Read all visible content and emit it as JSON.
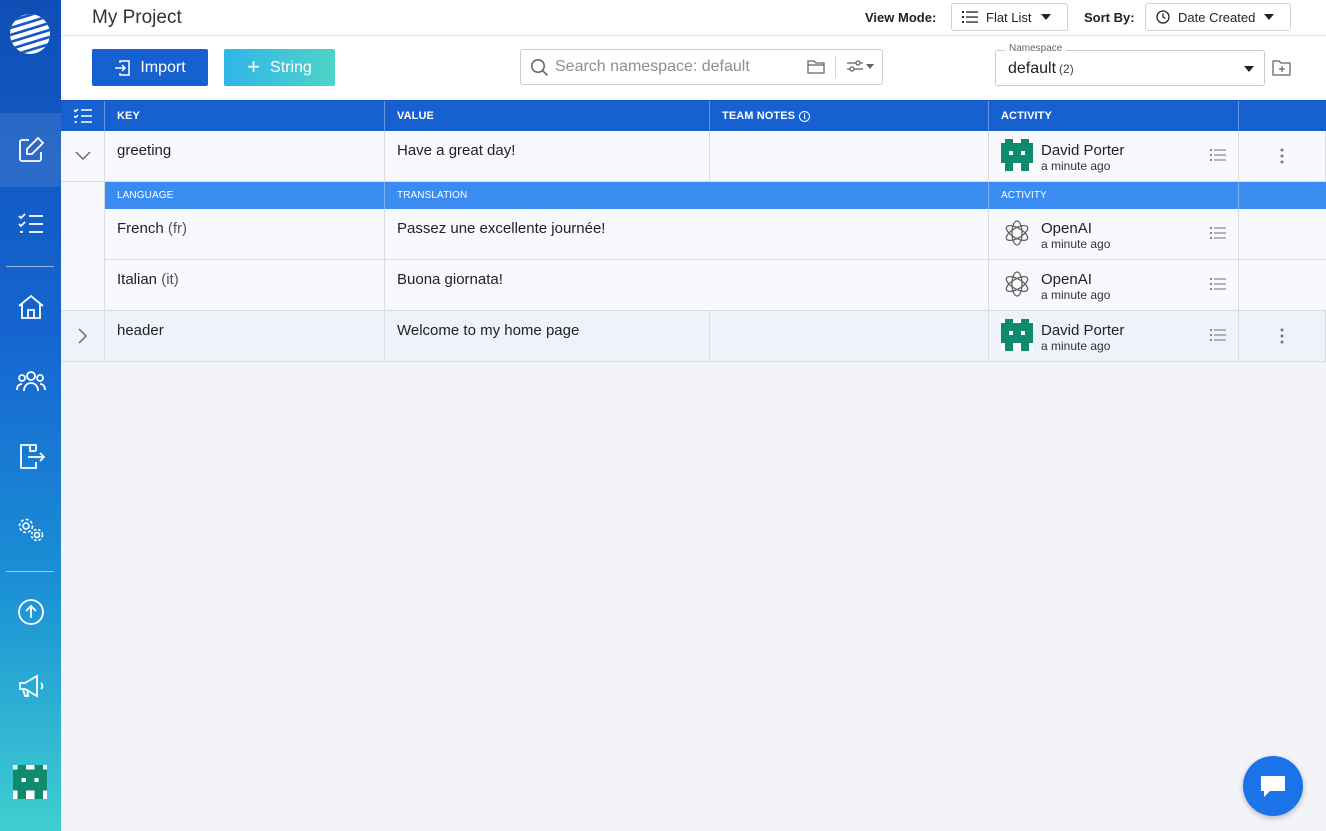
{
  "app": {
    "project_title": "My Project"
  },
  "topbar": {
    "view_mode_label": "View Mode:",
    "view_mode_value": "Flat List",
    "sort_by_label": "Sort By:",
    "sort_by_value": "Date Created"
  },
  "toolbar": {
    "import_label": "Import",
    "string_label": "String",
    "search_placeholder": "Search namespace: default",
    "namespace_label": "Namespace",
    "namespace_value": "default",
    "namespace_count": "(2)"
  },
  "sidebar": {
    "items": [
      "edit-icon",
      "checklist-icon",
      "home-icon",
      "team-icon",
      "export-icon",
      "settings-icon",
      "upload-icon",
      "announcement-icon"
    ]
  },
  "table": {
    "headers": {
      "key": "KEY",
      "value": "VALUE",
      "notes": "TEAM NOTES",
      "activity": "ACTIVITY"
    },
    "subheaders": {
      "language": "LANGUAGE",
      "translation": "TRANSLATION",
      "activity": "ACTIVITY"
    },
    "rows": [
      {
        "key": "greeting",
        "value": "Have a great day!",
        "notes": "",
        "activity_user": "David Porter",
        "activity_time": "a minute ago",
        "translations": [
          {
            "language": "French",
            "code": "(fr)",
            "text": "Passez une excellente journée!",
            "activity_user": "OpenAI",
            "activity_time": "a minute ago"
          },
          {
            "language": "Italian",
            "code": "(it)",
            "text": "Buona giornata!",
            "activity_user": "OpenAI",
            "activity_time": "a minute ago"
          }
        ]
      },
      {
        "key": "header",
        "value": "Welcome to my home page",
        "notes": "",
        "activity_user": "David Porter",
        "activity_time": "a minute ago"
      }
    ]
  },
  "colors": {
    "primary": "#1660cf",
    "subheader": "#3a8cf0",
    "avatar_green": "#0e8a6e"
  }
}
